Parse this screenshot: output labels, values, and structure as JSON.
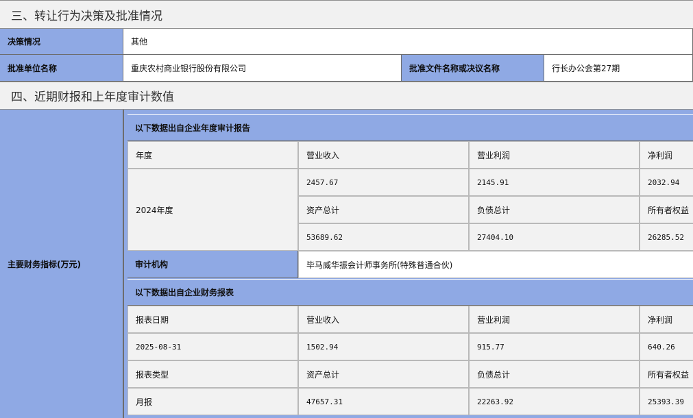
{
  "section3": {
    "title": "三、转让行为决策及批准情况",
    "decision_label": "决策情况",
    "decision_value": "其他",
    "approver_label": "批准单位名称",
    "approver_value": "重庆农村商业银行股份有限公司",
    "doc_label": "批准文件名称或决议名称",
    "doc_value": "行长办公会第27期"
  },
  "section4": {
    "title": "四、近期财报和上年度审计数值",
    "main_label": "主要财务指标(万元)",
    "audit": {
      "header": "以下数据出自企业年度审计报告",
      "col_labels": [
        "年度",
        "营业收入",
        "营业利润",
        "净利润"
      ],
      "year": "2024年度",
      "row1": [
        "2457.67",
        "2145.91",
        "2032.94"
      ],
      "labels2": [
        "资产总计",
        "负债总计",
        "所有者权益"
      ],
      "row2": [
        "53689.62",
        "27404.10",
        "26285.52"
      ],
      "agency_label": "审计机构",
      "agency_value": "毕马威华振会计师事务所(特殊普通合伙)"
    },
    "statement": {
      "header": "以下数据出自企业财务报表",
      "labels1": [
        "报表日期",
        "营业收入",
        "营业利润",
        "净利润"
      ],
      "values1": [
        "2025-08-31",
        "1502.94",
        "915.77",
        "640.26"
      ],
      "labels2": [
        "报表类型",
        "资产总计",
        "负债总计",
        "所有者权益"
      ],
      "values2": [
        "月报",
        "47657.31",
        "22263.92",
        "25393.39"
      ]
    }
  }
}
